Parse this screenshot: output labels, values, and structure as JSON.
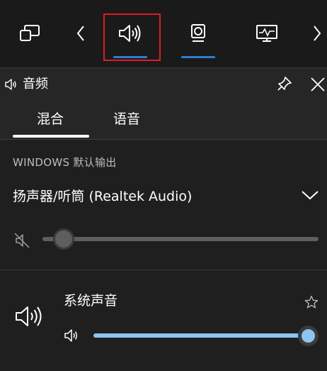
{
  "topbar": {
    "items": [
      {
        "name": "widget-menu",
        "icon": "widget-menu-icon"
      },
      {
        "name": "prev",
        "icon": "chevron-left-icon"
      },
      {
        "name": "audio",
        "icon": "speaker-icon",
        "selected": true
      },
      {
        "name": "capture",
        "icon": "capture-icon"
      },
      {
        "name": "performance",
        "icon": "monitor-icon"
      },
      {
        "name": "next",
        "icon": "chevron-right-icon"
      }
    ],
    "accent_color": "#2f7bd4",
    "highlight_color": "#e11b22"
  },
  "panel": {
    "title": "音频",
    "pin_icon": "pin-icon",
    "close_icon": "close-icon"
  },
  "tabs": [
    {
      "label": "混合",
      "selected": true
    },
    {
      "label": "语音",
      "selected": false
    }
  ],
  "default_output": {
    "section_label": "WINDOWS 默认输出",
    "device_name": "扬声器/听筒 (Realtek Audio)",
    "muted": true,
    "volume_fraction": 0.0
  },
  "apps": [
    {
      "name": "系统声音",
      "favorite": false,
      "volume_fraction": 1.0,
      "slider_color": "#8cc4f2"
    }
  ]
}
